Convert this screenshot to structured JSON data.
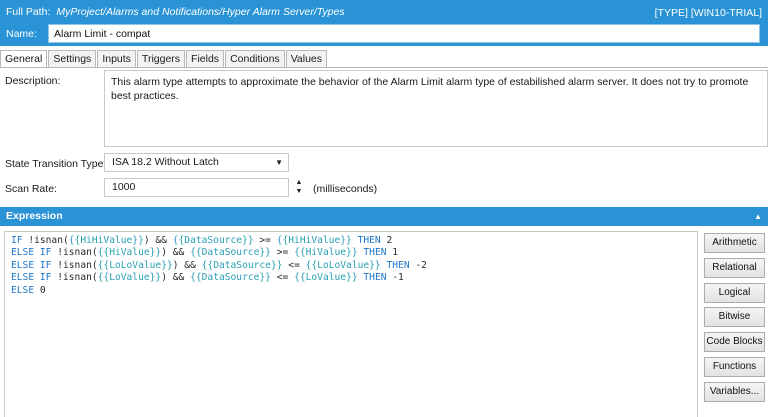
{
  "header": {
    "full_path_label": "Full Path:",
    "full_path_value": "MyProject/Alarms and Notifications/Hyper Alarm Server/Types",
    "badge": "[TYPE] [WIN10-TRIAL]",
    "name_label": "Name:",
    "name_value": "Alarm Limit - compat"
  },
  "tabs": [
    "General",
    "Settings",
    "Inputs",
    "Triggers",
    "Fields",
    "Conditions",
    "Values"
  ],
  "general": {
    "description_label": "Description:",
    "description_text": "This alarm type attempts to approximate the behavior of the Alarm Limit alarm type of estabilished alarm server. It does not try to promote best practices.",
    "state_transition_label": "State Transition Type:",
    "state_transition_value": "ISA 18.2 Without Latch",
    "scan_rate_label": "Scan Rate:",
    "scan_rate_value": "1000",
    "scan_rate_units": "(milliseconds)"
  },
  "expression": {
    "header": "Expression",
    "lines": [
      [
        [
          "kw",
          "IF "
        ],
        [
          "pl",
          "!isnan("
        ],
        [
          "var",
          "{{HiHiValue}}"
        ],
        [
          "pl",
          ") && "
        ],
        [
          "var",
          "{{DataSource}}"
        ],
        [
          "pl",
          " >= "
        ],
        [
          "var",
          "{{HiHiValue}}"
        ],
        [
          "kw",
          " THEN "
        ],
        [
          "pl",
          "2"
        ]
      ],
      [
        [
          "kw",
          "ELSE IF "
        ],
        [
          "pl",
          "!isnan("
        ],
        [
          "var",
          "{{HiValue}}"
        ],
        [
          "pl",
          ") && "
        ],
        [
          "var",
          "{{DataSource}}"
        ],
        [
          "pl",
          " >= "
        ],
        [
          "var",
          "{{HiValue}}"
        ],
        [
          "kw",
          " THEN "
        ],
        [
          "pl",
          "1"
        ]
      ],
      [
        [
          "kw",
          "ELSE IF "
        ],
        [
          "pl",
          "!isnan("
        ],
        [
          "var",
          "{{LoLoValue}}"
        ],
        [
          "pl",
          ") && "
        ],
        [
          "var",
          "{{DataSource}}"
        ],
        [
          "pl",
          " <= "
        ],
        [
          "var",
          "{{LoLoValue}}"
        ],
        [
          "kw",
          " THEN "
        ],
        [
          "pl",
          "-2"
        ]
      ],
      [
        [
          "kw",
          "ELSE IF "
        ],
        [
          "pl",
          "!isnan("
        ],
        [
          "var",
          "{{LoValue}}"
        ],
        [
          "pl",
          ") && "
        ],
        [
          "var",
          "{{DataSource}}"
        ],
        [
          "pl",
          " <= "
        ],
        [
          "var",
          "{{LoValue}}"
        ],
        [
          "kw",
          " THEN "
        ],
        [
          "pl",
          "-1"
        ]
      ],
      [
        [
          "kw",
          "ELSE "
        ],
        [
          "pl",
          "0"
        ]
      ]
    ]
  },
  "side_buttons": [
    "Arithmetic",
    "Relational",
    "Logical",
    "Bitwise",
    "Code Blocks",
    "Functions",
    "Variables..."
  ]
}
